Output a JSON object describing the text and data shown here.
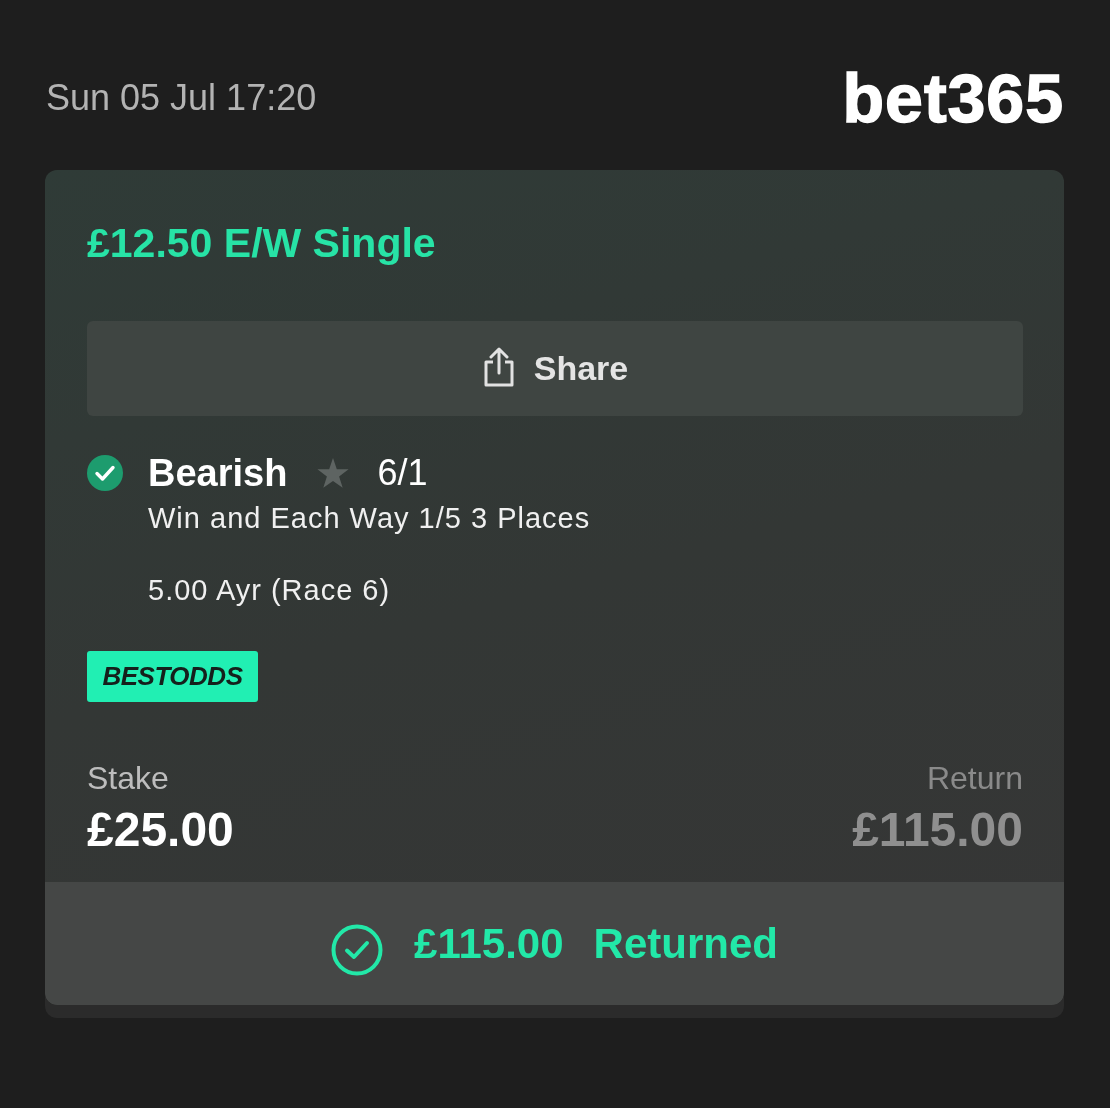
{
  "header": {
    "datetime": "Sun 05 Jul 17:20",
    "logo": "bet365"
  },
  "bet": {
    "title": "£12.50 E/W Single",
    "share_button": "Share",
    "selections": [
      {
        "won": true,
        "name": "Bearish",
        "odds": "6/1",
        "market": "Win and Each Way 1/5 3 Places",
        "event": "5.00 Ayr (Race 6)"
      }
    ],
    "badge": "BESTODDS",
    "stake": {
      "label": "Stake",
      "value": "£25.00"
    },
    "return": {
      "label": "Return",
      "value": "£115.00"
    },
    "status": {
      "amount": "£115.00",
      "label": "Returned"
    }
  }
}
